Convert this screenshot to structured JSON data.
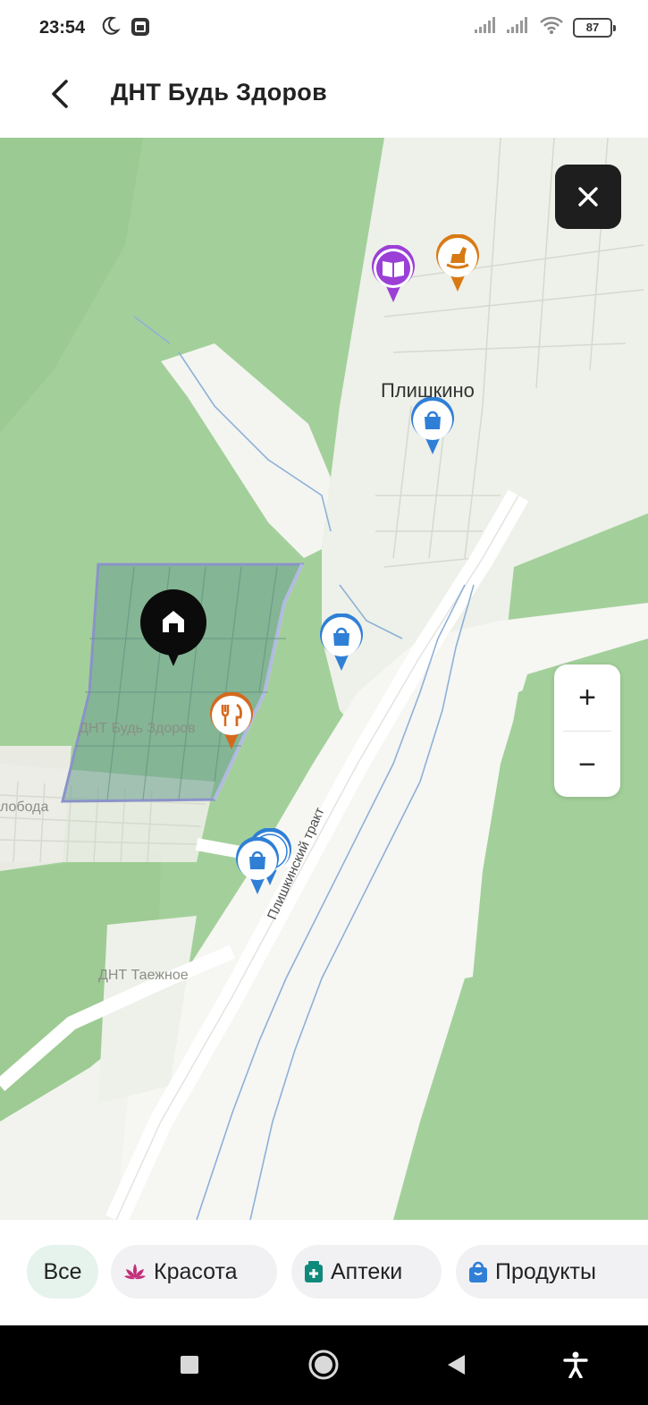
{
  "status_bar": {
    "time": "23:54",
    "battery": "87"
  },
  "header": {
    "title": "ДНТ Будь Здоров"
  },
  "map": {
    "labels": {
      "village": "Плишкино",
      "selected_area": "ДНТ Будь Здоров",
      "road": "Плишкинский тракт",
      "sloboda": "лобода",
      "taezhnoe": "ДНТ Таежное"
    },
    "zoom_in": "+",
    "zoom_out": "−",
    "colors": {
      "forest": "#9fcd95",
      "roads": "#f5f5f2",
      "selected_area_fill": "#6c9f90",
      "shop_pin": "#2f7fd6",
      "food_pin": "#d4691e",
      "books_pin": "#9b3fd6",
      "toy_pin": "#d87a14"
    }
  },
  "categories": [
    {
      "label": "Все",
      "icon": ""
    },
    {
      "label": "Красота",
      "icon": "lotus-icon"
    },
    {
      "label": "Аптеки",
      "icon": "pharmacy-icon"
    },
    {
      "label": "Продукты",
      "icon": "shopping-bag-icon"
    }
  ]
}
